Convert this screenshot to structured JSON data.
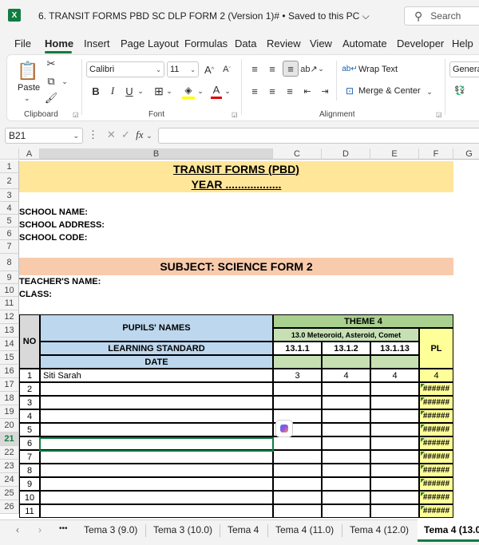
{
  "window": {
    "title": "6. TRANSIT FORMS PBD SC DLP FORM 2 (Version 1)# • Saved to this PC ⌵",
    "search_placeholder": "Search"
  },
  "menu": [
    "File",
    "Home",
    "Insert",
    "Page Layout",
    "Formulas",
    "Data",
    "Review",
    "View",
    "Automate",
    "Developer",
    "Help"
  ],
  "ribbon": {
    "clipboard_label": "Clipboard",
    "paste_label": "Paste",
    "font_label": "Font",
    "font_name": "Calibri",
    "font_size": "11",
    "alignment_label": "Alignment",
    "wrap_text": "Wrap Text",
    "merge_center": "Merge & Center",
    "number_format": "General"
  },
  "formula_bar": {
    "name_box": "B21",
    "formula": ""
  },
  "columns": [
    "A",
    "B",
    "C",
    "D",
    "E",
    "F",
    "G"
  ],
  "sheet": {
    "title": "TRANSIT FORMS (PBD)",
    "year": "YEAR ..................",
    "school_name": "SCHOOL NAME:",
    "school_address": "SCHOOL ADDRESS:",
    "school_code": "SCHOOL CODE:",
    "subject": "SUBJECT: SCIENCE FORM 2",
    "teacher": "TEACHER'S NAME:",
    "class": "CLASS:",
    "no": "NO",
    "pupils_names": "PUPILS' NAMES",
    "learning_standard": "LEARNING STANDARD",
    "date": "DATE",
    "theme": "THEME 4",
    "topic": "13.0 Meteoroid, Asteroid, Comet",
    "pl": "PL",
    "standards": [
      "13.1.1",
      "13.1.2",
      "13.1.13"
    ],
    "pupils": [
      {
        "no": "1",
        "name": "Siti Sarah",
        "s1": "3",
        "s2": "4",
        "s3": "4",
        "pl": "4"
      },
      {
        "no": "2",
        "name": "",
        "s1": "",
        "s2": "",
        "s3": "",
        "pl": "######"
      },
      {
        "no": "3",
        "name": "",
        "s1": "",
        "s2": "",
        "s3": "",
        "pl": "######"
      },
      {
        "no": "4",
        "name": "",
        "s1": "",
        "s2": "",
        "s3": "",
        "pl": "######"
      },
      {
        "no": "5",
        "name": "",
        "s1": "",
        "s2": "",
        "s3": "",
        "pl": "######"
      },
      {
        "no": "6",
        "name": "",
        "s1": "",
        "s2": "",
        "s3": "",
        "pl": "######"
      },
      {
        "no": "7",
        "name": "",
        "s1": "",
        "s2": "",
        "s3": "",
        "pl": "######"
      },
      {
        "no": "8",
        "name": "",
        "s1": "",
        "s2": "",
        "s3": "",
        "pl": "######"
      },
      {
        "no": "9",
        "name": "",
        "s1": "",
        "s2": "",
        "s3": "",
        "pl": "######"
      },
      {
        "no": "10",
        "name": "",
        "s1": "",
        "s2": "",
        "s3": "",
        "pl": "######"
      },
      {
        "no": "11",
        "name": "",
        "s1": "",
        "s2": "",
        "s3": "",
        "pl": "######"
      }
    ]
  },
  "sheet_tabs": [
    "Tema 3 (9.0)",
    "Tema 3 (10.0)",
    "Tema 4",
    "Tema 4 (11.0)",
    "Tema 4 (12.0)",
    "Tema 4 (13.0"
  ],
  "sheet_nav": {
    "prev": "‹",
    "next": "›",
    "more": "•••"
  },
  "colors": {
    "accent": "#107c41",
    "title_fill": "#ffe699",
    "subject_fill": "#f8cbad",
    "header_blue": "#bdd7ee",
    "theme_green": "#a9d08e",
    "topic_green": "#c6e0b4",
    "pl_yellow": "#ffff99"
  }
}
